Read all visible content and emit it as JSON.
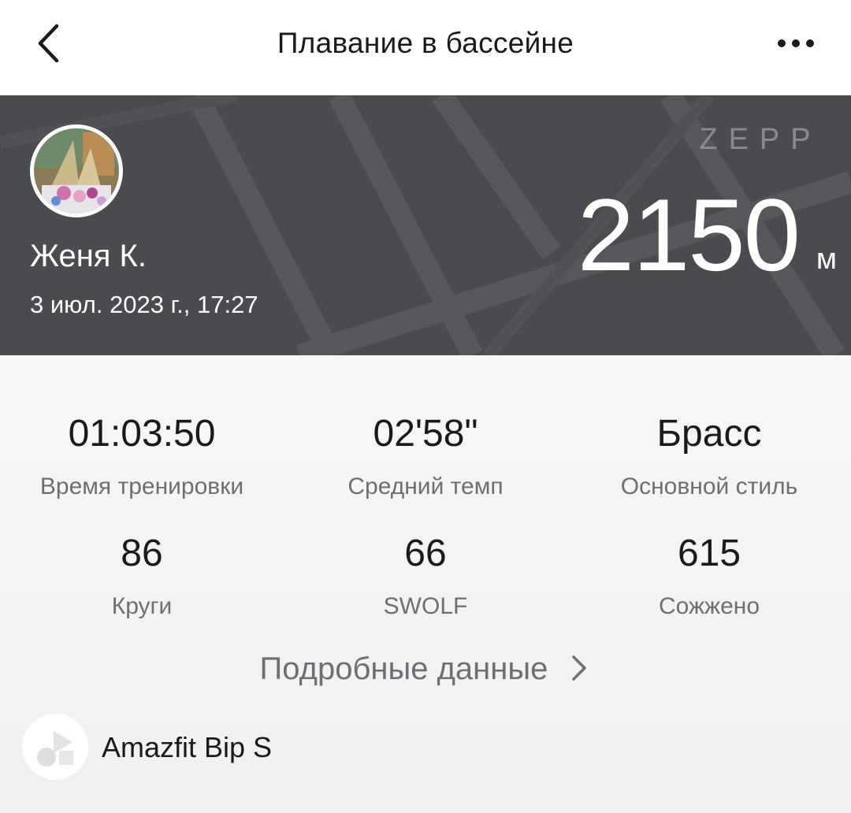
{
  "header": {
    "title": "Плавание в бассейне",
    "back_icon": "chevron-left-icon",
    "more_icon": "more-dots-icon"
  },
  "banner": {
    "brand": "ZEPP",
    "user_name": "Женя К.",
    "datetime": "3 июл. 2023 г., 17:27",
    "distance_value": "2150",
    "distance_unit": "м",
    "colors": {
      "background": "#4a4b4f",
      "text": "#ffffff"
    }
  },
  "stats": [
    {
      "value": "01:03:50",
      "label": "Время тренировки"
    },
    {
      "value": "02'58\"",
      "label": "Средний темп"
    },
    {
      "value": "Брасс",
      "label": "Основной стиль"
    },
    {
      "value": "86",
      "label": "Круги"
    },
    {
      "value": "66",
      "label": "SWOLF"
    },
    {
      "value": "615",
      "label": "Сожжено"
    }
  ],
  "details_link": {
    "label": "Подробные данные",
    "icon": "chevron-right-icon"
  },
  "device": {
    "name": "Amazfit Bip S",
    "icon": "device-shapes-icon"
  }
}
